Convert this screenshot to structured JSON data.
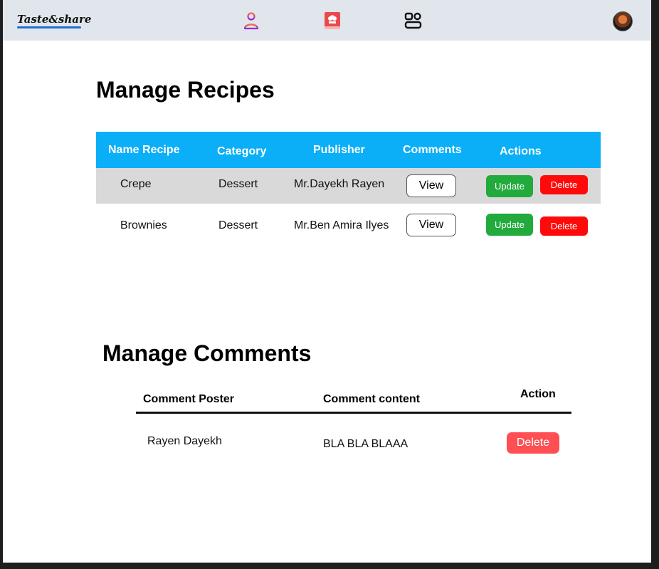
{
  "header": {
    "brand": "Taste&share",
    "icons": [
      "user-icon",
      "recipe-book-icon",
      "dashboard-icon"
    ],
    "accent_colors": {
      "user": "#9b32e8",
      "recipe": "#e84a4a"
    }
  },
  "recipes": {
    "title": "Manage Recipes",
    "columns": [
      "Name Recipe",
      "Category",
      "Publisher",
      "Comments",
      "Actions"
    ],
    "rows": [
      {
        "name": "Crepe",
        "category": "Dessert",
        "publisher": "Mr.Dayekh Rayen",
        "view": "View",
        "update": "Update",
        "delete": "Delete"
      },
      {
        "name": "Brownies",
        "category": "Dessert",
        "publisher": "Mr.Ben Amira Ilyes",
        "view": "View",
        "update": "Update",
        "delete": "Delete"
      }
    ]
  },
  "comments": {
    "title": "Manage Comments",
    "columns": [
      "Comment Poster",
      "Comment content",
      "Action"
    ],
    "rows": [
      {
        "poster": "Rayen Dayekh",
        "content": "BLA BLA BLAAA",
        "delete": "Delete"
      }
    ]
  },
  "colors": {
    "header_bg": "#e1e6ed",
    "table_header": "#0aaff7",
    "update_btn": "#22aa3c",
    "delete_btn": "#ff0a0a",
    "comment_delete_btn": "#fe4f55"
  }
}
